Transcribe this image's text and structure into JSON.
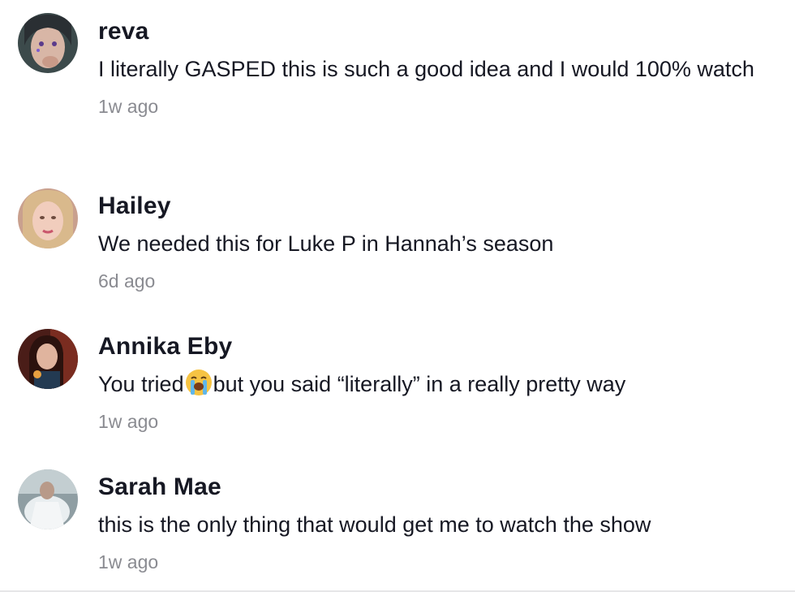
{
  "comments": [
    {
      "username": "reva",
      "text": "I literally GASPED this is such a good idea and I would 100% watch",
      "time": "1w ago"
    },
    {
      "username": "Hailey",
      "text": "We needed this for Luke P in Hannah’s season",
      "time": "6d ago"
    },
    {
      "username": "Annika Eby",
      "text_before": "You tried",
      "emoji": "😭",
      "text_after": "but you said “literally” in a really pretty way",
      "time": "1w ago"
    },
    {
      "username": "Sarah Mae",
      "text": "this is the only thing that would get me to watch the show",
      "time": "1w ago"
    }
  ],
  "icons": {
    "emoji": "loudly-crying-face-icon"
  }
}
